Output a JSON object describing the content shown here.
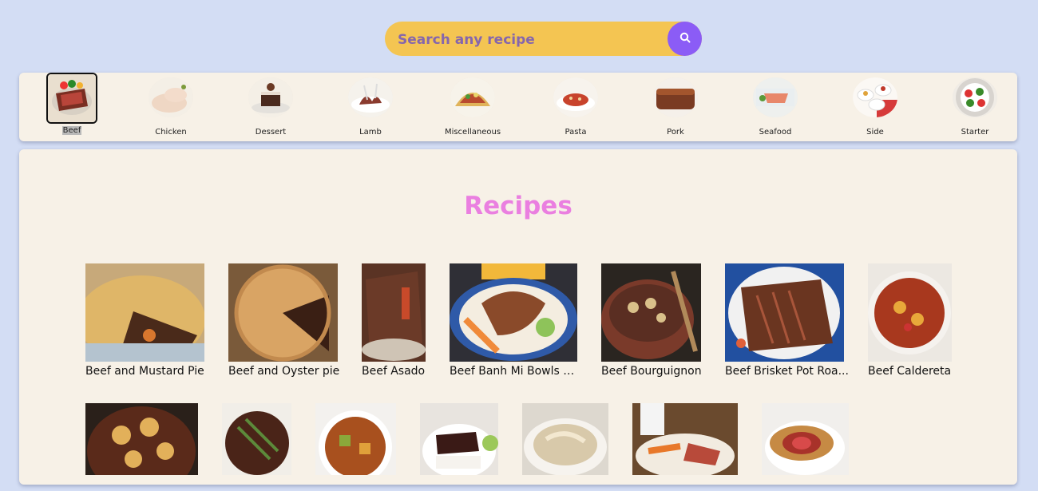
{
  "search": {
    "placeholder": "Search any recipe",
    "value": ""
  },
  "colors": {
    "background": "#d3ddf4",
    "search_bg": "#f4c552",
    "search_button": "#8b5cf6",
    "panel": "#f7f1e7",
    "title": "#ea7fe0"
  },
  "categories": [
    {
      "label": "Beef",
      "active": true
    },
    {
      "label": "Chicken",
      "active": false
    },
    {
      "label": "Dessert",
      "active": false
    },
    {
      "label": "Lamb",
      "active": false
    },
    {
      "label": "Miscellaneous",
      "active": false
    },
    {
      "label": "Pasta",
      "active": false
    },
    {
      "label": "Pork",
      "active": false
    },
    {
      "label": "Seafood",
      "active": false
    },
    {
      "label": "Side",
      "active": false
    },
    {
      "label": "Starter",
      "active": false
    }
  ],
  "main": {
    "title": "Recipes",
    "recipes": [
      {
        "name": "Beef and Mustard Pie"
      },
      {
        "name": "Beef and Oyster pie"
      },
      {
        "name": "Beef Asado"
      },
      {
        "name": "Beef Banh Mi Bowls w..."
      },
      {
        "name": "Beef Bourguignon"
      },
      {
        "name": "Beef Brisket Pot Roa..."
      },
      {
        "name": "Beef Caldereta"
      }
    ],
    "recipes_row2_count": 7
  }
}
